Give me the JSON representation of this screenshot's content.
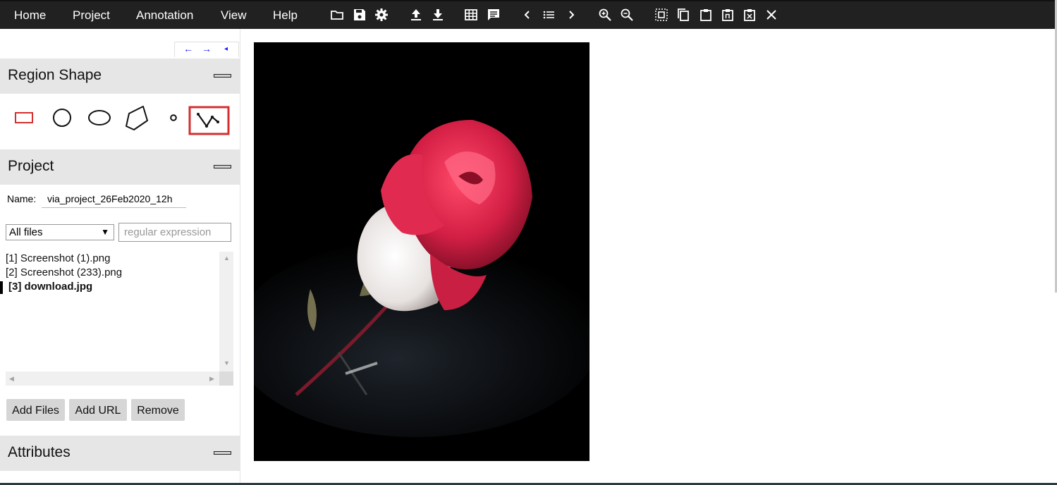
{
  "menubar": {
    "items": [
      "Home",
      "Project",
      "Annotation",
      "View",
      "Help"
    ],
    "toolbar_icons": [
      "folder-open-icon",
      "save-icon",
      "settings-gear-icon",
      "upload-icon",
      "download-icon",
      "grid-view-icon",
      "comment-icon",
      "previous-chevron-icon",
      "list-icon",
      "next-chevron-icon",
      "zoom-in-icon",
      "zoom-out-icon",
      "select-all-regions-icon",
      "copy-icon",
      "paste-icon",
      "paste-n-icon",
      "delete-region-icon",
      "close-icon"
    ]
  },
  "leftpanel": {
    "nav": {
      "prev": "←",
      "next": "→",
      "collapse": "◂"
    },
    "region_shape": {
      "title": "Region Shape",
      "tools": [
        "rectangle",
        "circle",
        "ellipse",
        "polygon",
        "point",
        "polyline"
      ],
      "selected_tool": "polyline"
    },
    "project": {
      "title": "Project",
      "name_label": "Name:",
      "name_value": "via_project_26Feb2020_12h",
      "filter_selected": "All files",
      "regex_placeholder": "regular expression",
      "files": [
        "[1] Screenshot (1).png",
        "[2] Screenshot (233).png",
        "[3] download.jpg"
      ],
      "active_file_index": 2,
      "buttons": {
        "add_files": "Add Files",
        "add_url": "Add URL",
        "remove": "Remove"
      }
    },
    "attributes": {
      "title": "Attributes"
    }
  },
  "colors": {
    "menubar_bg": "#212121",
    "section_bg": "#e6e6e6",
    "selected_tool": "#d32f2f",
    "nav_arrows": "#1a1aff"
  }
}
